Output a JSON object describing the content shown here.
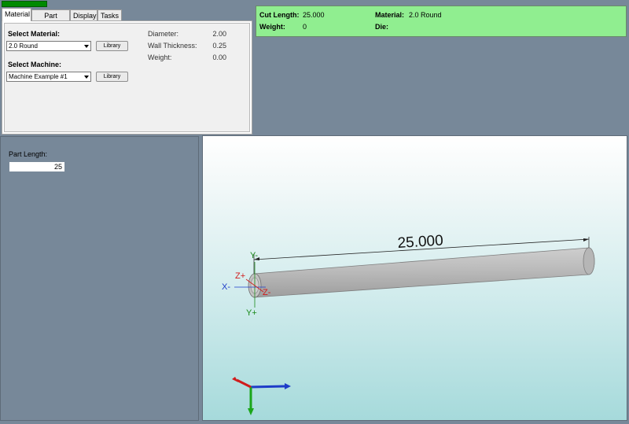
{
  "tabs": [
    {
      "label": "Material",
      "active": true
    },
    {
      "label": "Part Details",
      "active": false
    },
    {
      "label": "Display",
      "active": false
    },
    {
      "label": "Tasks",
      "active": false
    }
  ],
  "material_panel": {
    "select_material_label": "Select Material:",
    "material_value": "2.0 Round",
    "library_label": "Library",
    "select_machine_label": "Select Machine:",
    "machine_value": "Machine Example #1",
    "properties": [
      {
        "label": "Diameter:",
        "value": "2.00"
      },
      {
        "label": "Wall Thickness:",
        "value": "0.25"
      },
      {
        "label": "Weight:",
        "value": "0.00"
      }
    ]
  },
  "info": {
    "cut_length_label": "Cut Length:",
    "cut_length_value": "25.000",
    "weight_label": "Weight:",
    "weight_value": "0",
    "material_label": "Material:",
    "material_value": "2.0 Round",
    "die_label": "Die:",
    "die_value": ""
  },
  "part": {
    "length_label": "Part Length:",
    "length_value": "25"
  },
  "viewport": {
    "dimension_text": "25.000",
    "axis_labels": {
      "y_minus": "Y-",
      "y_plus": "Y+",
      "z_plus": "Z+",
      "z_minus": "Z-",
      "x_minus": "X-"
    },
    "colors": {
      "x_axis": "#1e3cc8",
      "y_axis": "#1a8a1a",
      "z_axis": "#d01c1c",
      "tube": "#bdbdbd"
    }
  },
  "progress": 1
}
